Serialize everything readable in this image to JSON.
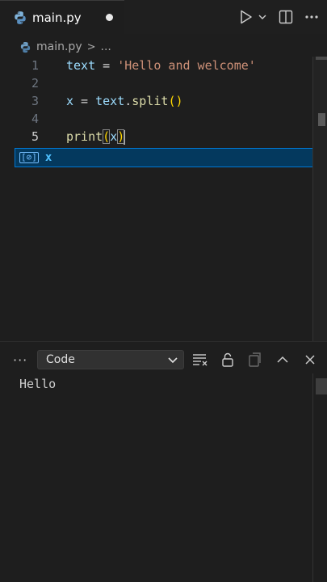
{
  "tab": {
    "filename": "main.py",
    "icon": "python-icon",
    "unsaved": true
  },
  "toolbar": {
    "run_icon": "play-icon",
    "run_dropdown_icon": "chevron-down-icon",
    "split_icon": "split-editor-icon",
    "more_icon": "more-icon"
  },
  "breadcrumb": {
    "file": "main.py",
    "separator": ">",
    "rest": "..."
  },
  "editor": {
    "lines": [
      {
        "number": "1",
        "tokens": {
          "var": "text",
          "eq": " = ",
          "str": "'Hello and welcome'"
        }
      },
      {
        "number": "2"
      },
      {
        "number": "3",
        "tokens": {
          "var": "x",
          "eq": " = ",
          "obj": "text",
          "dot": ".",
          "method": "split",
          "parens": "()"
        }
      },
      {
        "number": "4"
      },
      {
        "number": "5",
        "tokens": {
          "fn": "print",
          "open": "(",
          "arg": "x",
          "close": ")"
        }
      }
    ]
  },
  "suggestion": {
    "icon": "variable-icon",
    "icon_text": "[⊘]",
    "label": "x"
  },
  "panel": {
    "more_label": "···",
    "select_value": "Code",
    "output": "Hello",
    "actions": [
      "clear-output-icon",
      "lock-icon",
      "copy-icon",
      "maximize-icon",
      "close-icon"
    ]
  },
  "colors": {
    "background": "#1e1e1e",
    "variable": "#9cdcfe",
    "string": "#ce9178",
    "function": "#dcdcaa",
    "suggest_bg": "#04395e"
  }
}
